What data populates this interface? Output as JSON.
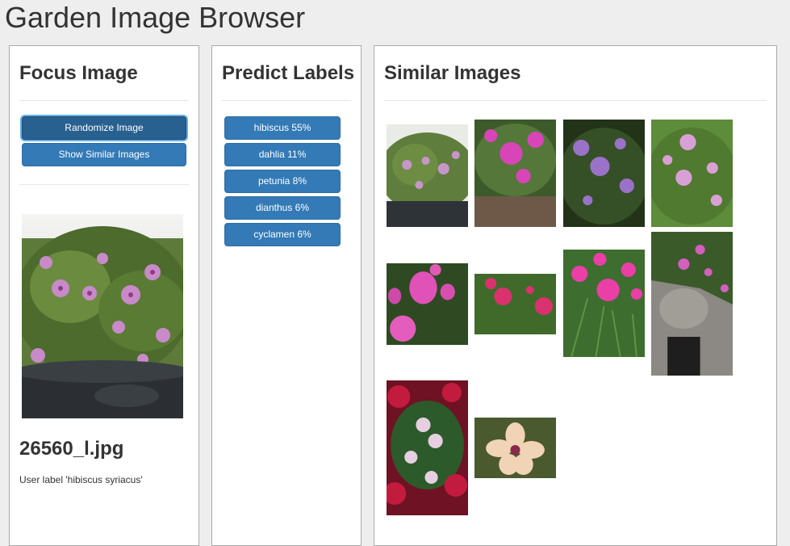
{
  "app": {
    "title": "Garden Image Browser"
  },
  "focus": {
    "heading": "Focus Image",
    "randomize_label": "Randomize Image",
    "similar_label": "Show Similar Images",
    "filename": "26560_l.jpg",
    "user_label": "User label 'hibiscus syriacus'"
  },
  "predict": {
    "heading": "Predict Labels",
    "labels": [
      {
        "text": "hibiscus 55%"
      },
      {
        "text": "dahlia 11%"
      },
      {
        "text": "petunia 8%"
      },
      {
        "text": "dianthus 6%"
      },
      {
        "text": "cyclamen 6%"
      }
    ]
  },
  "similar": {
    "heading": "Similar Images"
  },
  "colors": {
    "button": "#337ab7",
    "button_active": "#286090",
    "panel_border": "#aaaaaa",
    "background": "#eeeeee"
  }
}
